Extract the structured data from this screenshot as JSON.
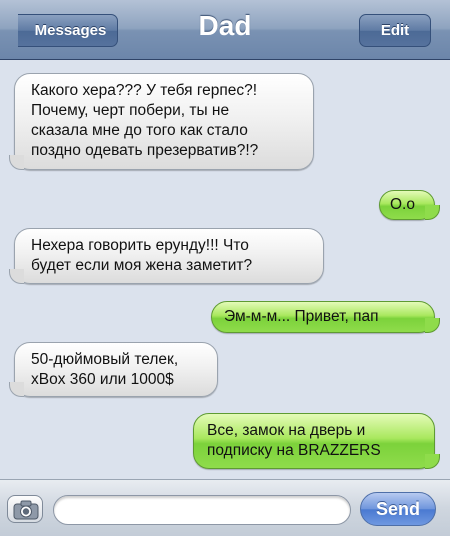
{
  "navbar": {
    "title": "Dad",
    "back_label": "Messages",
    "edit_label": "Edit"
  },
  "messages": [
    {
      "direction": "received",
      "text": "Какого хера??? У тебя герпес?!\nПочему, черт побери, ты не\nсказала мне до того как стало\nпоздно одевать презерватив?!?"
    },
    {
      "direction": "sent",
      "text": "О.о"
    },
    {
      "direction": "received",
      "text": "Нехера говорить ерунду!!! Что\nбудет если моя жена заметит?"
    },
    {
      "direction": "sent",
      "text": "Эм-м-м... Привет, пап"
    },
    {
      "direction": "received",
      "text": "50-дюймовый телек,\nxBox 360 или 1000$"
    },
    {
      "direction": "sent",
      "text": "Все, замок на дверь и\nподписку на BRAZZERS"
    }
  ],
  "input": {
    "value": "",
    "placeholder": "",
    "send_label": "Send"
  },
  "icons": {
    "camera": "camera-icon"
  },
  "colors": {
    "sent_bubble": "#8fdc4b",
    "received_bubble": "#f1f1f1",
    "navbar": "#7a92b3",
    "send_button": "#4a79d1"
  }
}
